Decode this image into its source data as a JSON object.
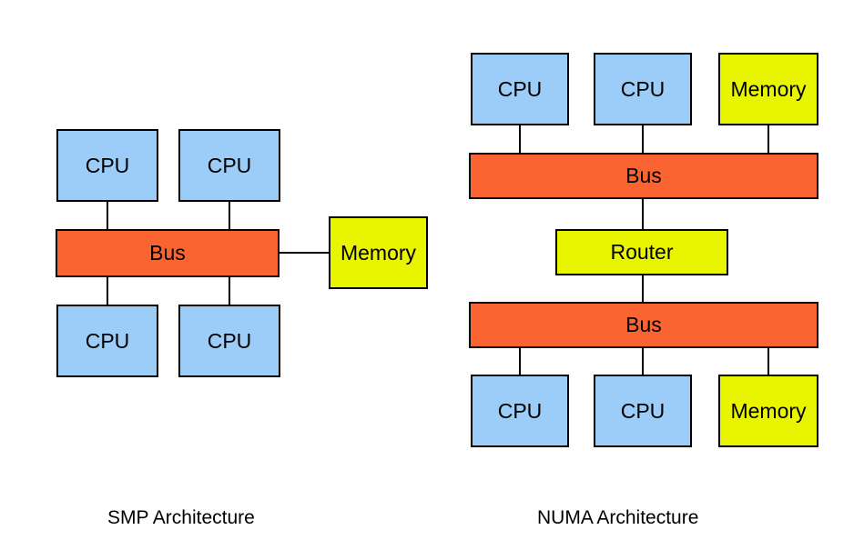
{
  "diagram": {
    "title_smp": "SMP Architecture",
    "title_numa": "NUMA Architecture",
    "colors": {
      "cpu": "#9ccdf8",
      "memory": "#e9f500",
      "bus": "#fa6432",
      "router": "#e9f500",
      "stroke": "#000000",
      "background": "#ffffff"
    },
    "smp": {
      "caption": "SMP Architecture",
      "cpu_top_left": "CPU",
      "cpu_top_right": "CPU",
      "bus": "Bus",
      "memory": "Memory",
      "cpu_bottom_left": "CPU",
      "cpu_bottom_right": "CPU"
    },
    "numa": {
      "caption": "NUMA Architecture",
      "cpu_top_left": "CPU",
      "cpu_top_mid": "CPU",
      "memory_top": "Memory",
      "bus_top": "Bus",
      "router": "Router",
      "bus_bottom": "Bus",
      "cpu_bottom_left": "CPU",
      "cpu_bottom_mid": "CPU",
      "memory_bottom": "Memory"
    }
  }
}
